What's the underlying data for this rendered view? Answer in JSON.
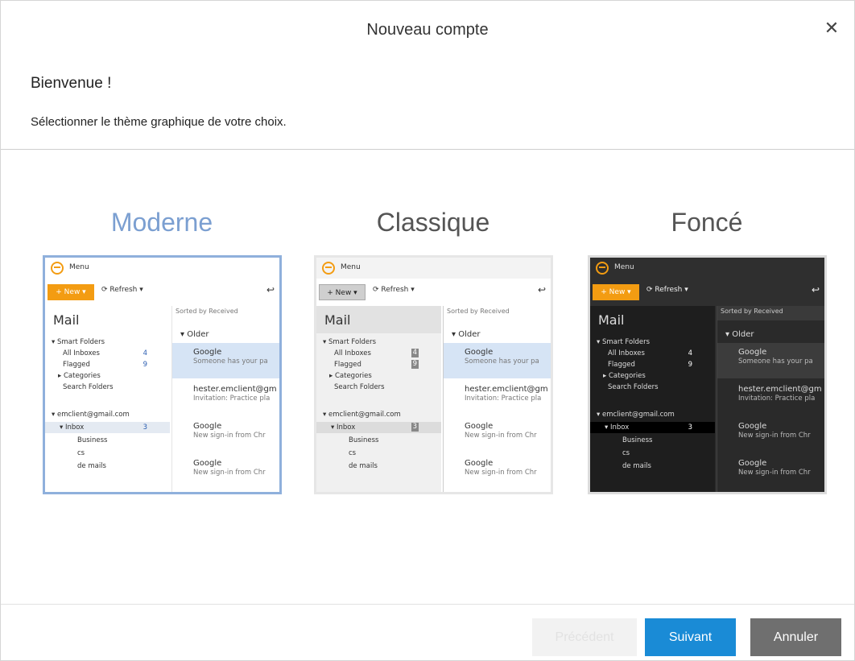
{
  "dialog": {
    "title": "Nouveau compte",
    "close_symbol": "✕",
    "welcome": "Bienvenue !",
    "subtitle": "Sélectionner le thème graphique de votre choix."
  },
  "themes": [
    {
      "name": "Moderne",
      "selected": true
    },
    {
      "name": "Classique",
      "selected": false
    },
    {
      "name": "Foncé",
      "selected": false
    }
  ],
  "preview": {
    "menu": "Menu",
    "new": "+ New ▾",
    "refresh": "⟳ Refresh ▾",
    "reply_symbol": "↩",
    "mail": "Mail",
    "smart_folders": "▾ Smart Folders",
    "all_inboxes": "All Inboxes",
    "all_inboxes_count": "4",
    "flagged": "Flagged",
    "flagged_count": "9",
    "categories": "▸ Categories",
    "search_folders": "Search Folders",
    "account": "▾ emclient@gmail.com",
    "inbox": "▾ Inbox",
    "inbox_count": "3",
    "business": "Business",
    "cs": "cs",
    "de_mails": "de mails",
    "sorted": "Sorted by Received",
    "older": "▾ Older",
    "messages": [
      {
        "sender": "Google",
        "preview": "Someone has your pa",
        "selected": true
      },
      {
        "sender": "hester.emclient@gm",
        "preview": "Invitation: Practice pla",
        "selected": false
      },
      {
        "sender": "Google",
        "preview": "New sign-in from Chr",
        "selected": false
      },
      {
        "sender": "Google",
        "preview": "New sign-in from Chr",
        "selected": false
      }
    ]
  },
  "buttons": {
    "previous": "Précédent",
    "next": "Suivant",
    "cancel": "Annuler"
  },
  "colors": {
    "accent": "#1a8bd6",
    "selected_theme_label": "#7b9fd1",
    "cancel": "#6f6f6f",
    "new_button": "#f39c12"
  }
}
